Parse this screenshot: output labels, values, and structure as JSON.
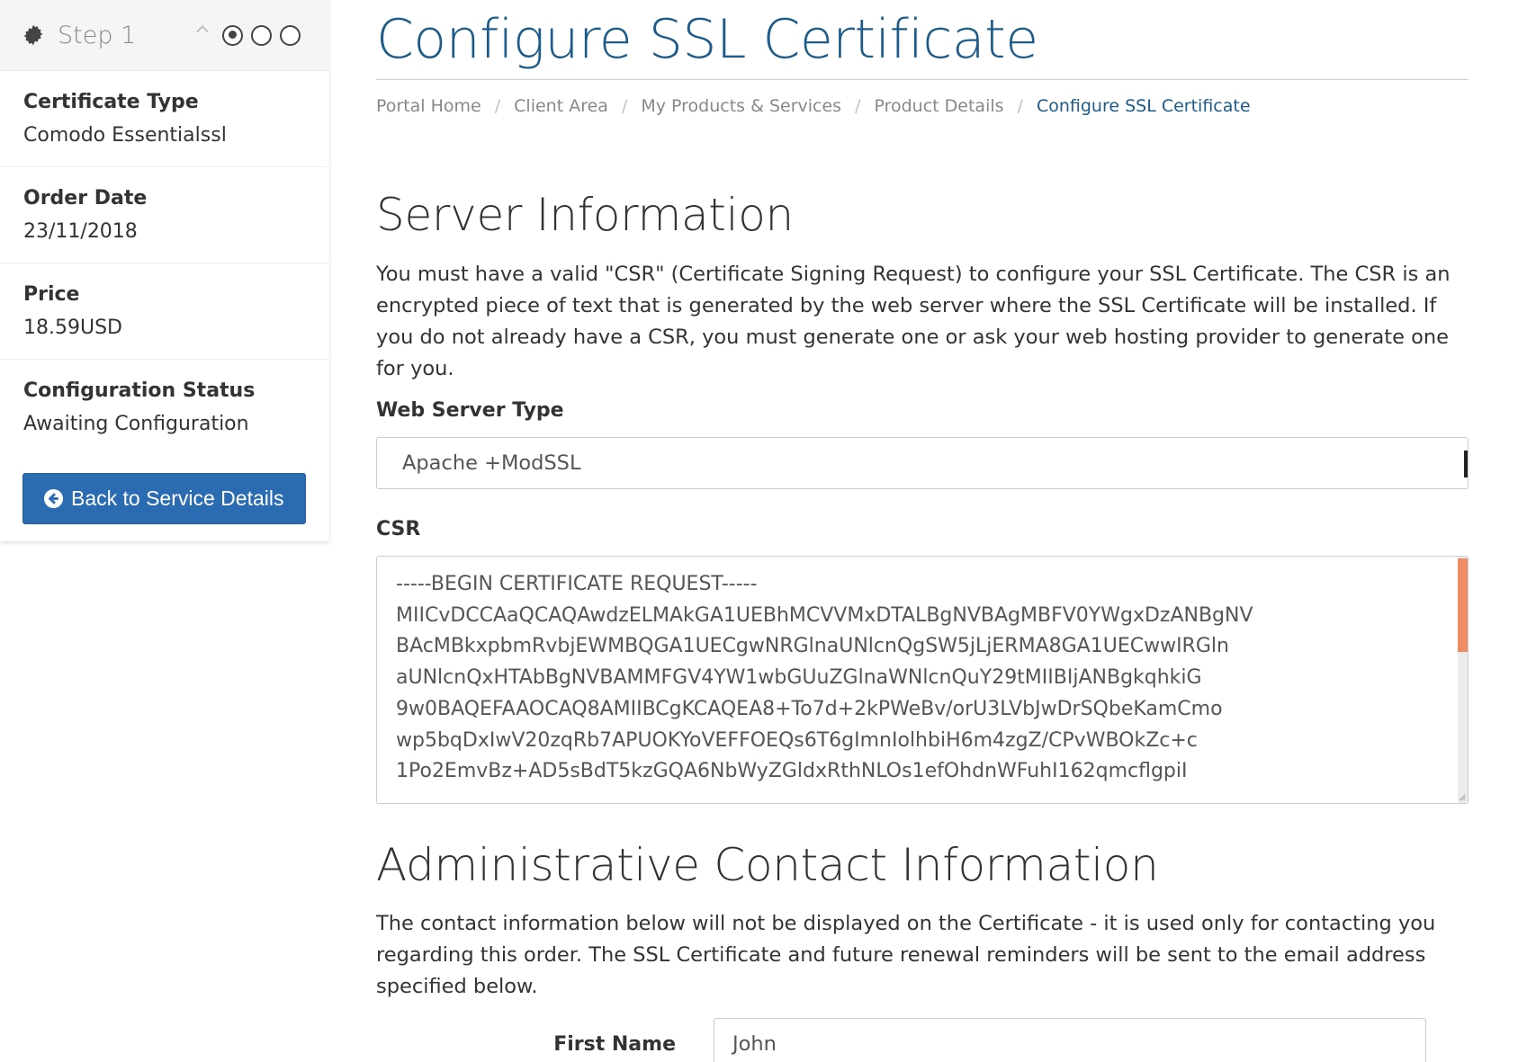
{
  "sidebar": {
    "step_label": "Step 1",
    "step_dots": 3,
    "active_step": 1,
    "items": [
      {
        "label": "Certificate Type",
        "value": "Comodo Essentialssl"
      },
      {
        "label": "Order Date",
        "value": "23/11/2018"
      },
      {
        "label": "Price",
        "value": "18.59USD"
      },
      {
        "label": "Configuration Status",
        "value": "Awaiting Configuration"
      }
    ],
    "back_button": {
      "label": "Back to Service Details",
      "icon": "arrow-circle-left-icon",
      "color": "#2a6bb2"
    }
  },
  "page": {
    "title": "Configure SSL Certificate",
    "title_color": "#1c5b8a"
  },
  "breadcrumb": [
    "Portal Home",
    "Client Area",
    "My Products & Services",
    "Product Details",
    "Configure SSL Certificate"
  ],
  "server_info": {
    "heading": "Server Information",
    "description": "You must have a valid \"CSR\" (Certificate Signing Request) to configure your SSL Certificate. The CSR is an encrypted piece of text that is generated by the web server where the SSL Certificate will be installed. If you do not already have a CSR, you must generate one or ask your web hosting provider to generate one for you.",
    "web_server_label": "Web Server Type",
    "web_server_value": "Apache +ModSSL",
    "csr_label": "CSR",
    "csr_value": "-----BEGIN CERTIFICATE REQUEST-----\nMIICvDCCAaQCAQAwdzELMAkGA1UEBhMCVVMxDTALBgNVBAgMBFV0YWgxDzANBgNV\nBAcMBkxpbmRvbjEWMBQGA1UECgwNRGlnaUNlcnQgSW5jLjERMA8GA1UECwwIRGln\naUNlcnQxHTAbBgNVBAMMFGV4YW1wbGUuZGlnaWNlcnQuY29tMIIBIjANBgkqhkiG\n9w0BAQEFAAOCAQ8AMIIBCgKCAQEA8+To7d+2kPWeBv/orU3LVbJwDrSQbeKamCmo\nwp5bqDxIwV20zqRb7APUOKYoVEFFOEQs6T6gImnIolhbiH6m4zgZ/CPvWBOkZc+c\n1Po2EmvBz+AD5sBdT5kzGQA6NbWyZGldxRthNLOs1efOhdnWFuhI162qmcflgpiI"
  },
  "admin_contact": {
    "heading": "Administrative Contact Information",
    "description": "The contact information below will not be displayed on the Certificate - it is used only for contacting you regarding this order. The SSL Certificate and future renewal reminders will be sent to the email address specified below.",
    "first_name_label": "First Name",
    "first_name_value": "John"
  },
  "colors": {
    "accent": "#1c5b8a",
    "button": "#2a6bb2",
    "scroll_thumb": "#ee8d65"
  }
}
